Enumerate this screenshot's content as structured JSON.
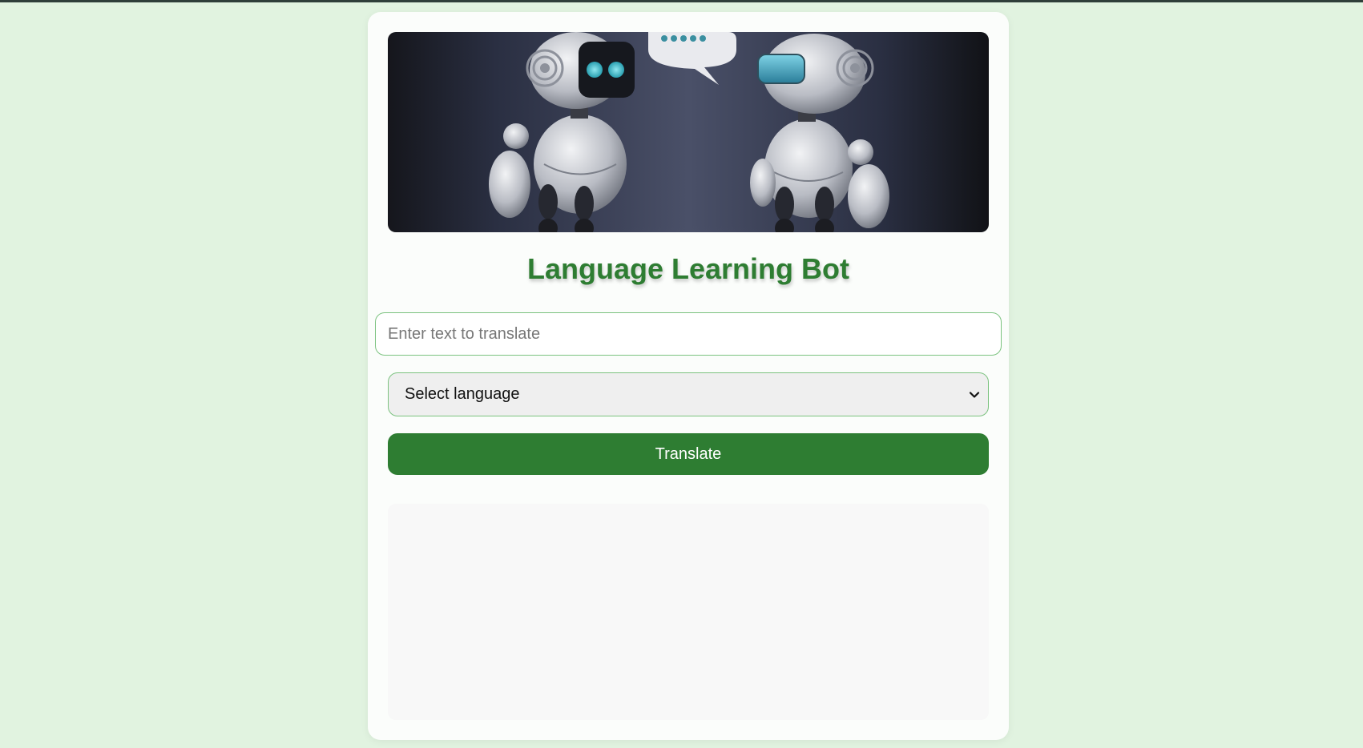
{
  "app": {
    "title": "Language Learning Bot"
  },
  "banner": {
    "image_name": "two-robots-talking-image"
  },
  "form": {
    "text_placeholder": "Enter text to translate",
    "text_value": "",
    "language_selected": "Select language",
    "translate_label": "Translate"
  },
  "output": {
    "text": ""
  },
  "colors": {
    "page_bg": "#e1f3e0",
    "card_bg": "#fbfdfb",
    "accent": "#2e7d32",
    "input_border": "#7bc27f",
    "select_bg": "#efefef",
    "output_bg": "#f8f8f8"
  },
  "icons": {
    "select_arrow": "chevron-down-icon"
  }
}
